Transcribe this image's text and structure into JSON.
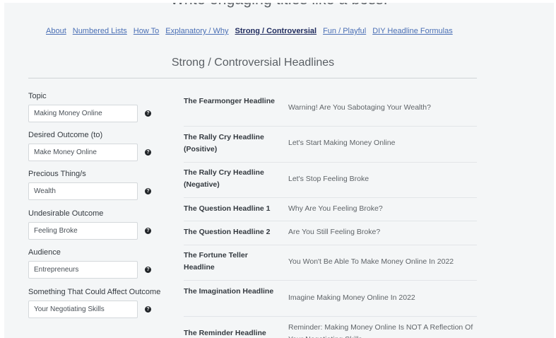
{
  "hero": {
    "title": "Write engaging titles like a boss!"
  },
  "nav": {
    "items": [
      {
        "label": "About"
      },
      {
        "label": "Numbered Lists"
      },
      {
        "label": "How To"
      },
      {
        "label": "Explanatory / Why"
      },
      {
        "label": "Strong / Controversial"
      },
      {
        "label": "Fun / Playful"
      },
      {
        "label": "DIY Headline Formulas"
      }
    ],
    "active": "Strong / Controversial"
  },
  "section": {
    "title": "Strong / Controversial Headlines"
  },
  "fields": [
    {
      "label": "Topic",
      "value": "Making Money Online"
    },
    {
      "label": "Desired Outcome (to)",
      "value": "Make Money Online"
    },
    {
      "label": "Precious Thing/s",
      "value": "Wealth"
    },
    {
      "label": "Undesirable Outcome",
      "value": "Feeling Broke"
    },
    {
      "label": "Audience",
      "value": "Entrepreneurs"
    },
    {
      "label": "Something That Could Affect Outcome",
      "value": "Your Negotiating Skills"
    }
  ],
  "help_icon_glyph": "?",
  "headlines": [
    {
      "name": "The Fearmonger Headline",
      "text": "Warning! Are You Sabotaging Your Wealth?"
    },
    {
      "name": "The Rally Cry Headline (Positive)",
      "text": "Let's Start Making Money Online"
    },
    {
      "name": "The Rally Cry Headline (Negative)",
      "text": "Let's Stop Feeling Broke"
    },
    {
      "name": "The Question Headline 1",
      "text": "Why Are You Feeling Broke?"
    },
    {
      "name": "The Question Headline 2",
      "text": "Are You Still Feeling Broke?"
    },
    {
      "name": "The Fortune Teller Headline",
      "text": "You Won't Be Able To Make Money Online In 2022"
    },
    {
      "name": "The Imagination Headline",
      "text": "Imagine Making Money Online In 2022"
    },
    {
      "name": "The Reminder Headline",
      "text": "Reminder: Making Money Online Is NOT A Reflection Of Your Negotiating Skills"
    }
  ]
}
